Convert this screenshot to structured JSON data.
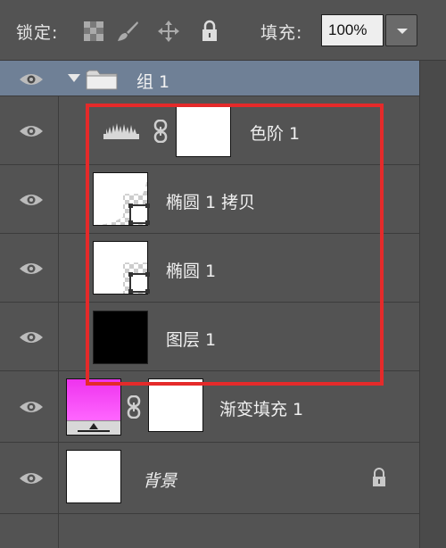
{
  "toolbar": {
    "lock_label": "锁定:",
    "fill_label": "填充:",
    "fill_value": "100%",
    "icons": [
      "lock-transparent-pixels-icon",
      "lock-image-pixels-icon",
      "lock-position-icon",
      "lock-all-icon",
      "chevron-down-icon"
    ]
  },
  "layers": {
    "group": {
      "name": "组 1",
      "expanded": true
    },
    "items": [
      {
        "name": "色阶 1",
        "type": "levels-adjustment"
      },
      {
        "name": "椭圆 1 拷贝",
        "type": "shape"
      },
      {
        "name": "椭圆 1",
        "type": "shape"
      },
      {
        "name": "图层 1",
        "type": "pixel"
      },
      {
        "name": "渐变填充 1",
        "type": "gradient-fill"
      },
      {
        "name": "背景",
        "type": "background",
        "locked": true
      }
    ]
  },
  "colors": {
    "panel_bg": "#535353",
    "selected_row": "#6f8096",
    "highlight_frame": "#e52a2a",
    "gradient_start": "#ee33ee",
    "gradient_end": "#ff66ff"
  }
}
